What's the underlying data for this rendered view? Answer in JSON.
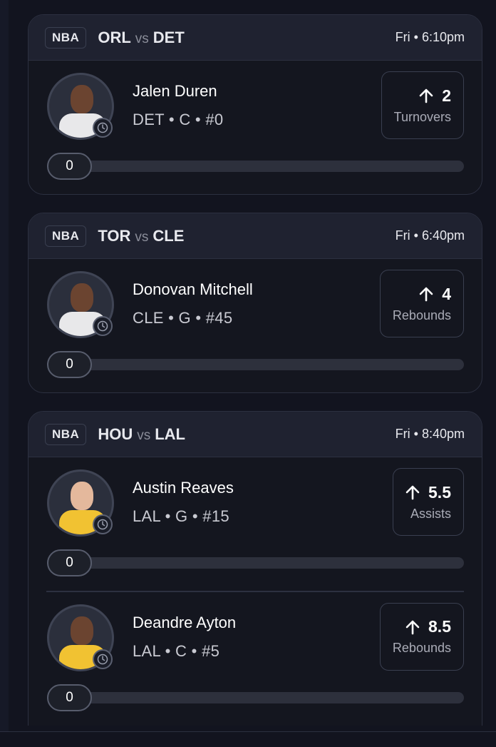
{
  "games": [
    {
      "league": "NBA",
      "team_a": "ORL",
      "vs": "vs",
      "team_b": "DET",
      "time": "Fri • 6:10pm",
      "picks": [
        {
          "name": "Jalen Duren",
          "meta": "DET • C • #0",
          "direction": "up",
          "line": "2",
          "stat": "Turnovers",
          "progress": "0",
          "jersey": "#e8e8ea",
          "skin": "dark"
        }
      ]
    },
    {
      "league": "NBA",
      "team_a": "TOR",
      "vs": "vs",
      "team_b": "CLE",
      "time": "Fri • 6:40pm",
      "picks": [
        {
          "name": "Donovan Mitchell",
          "meta": "CLE • G • #45",
          "direction": "up",
          "line": "4",
          "stat": "Rebounds",
          "progress": "0",
          "jersey": "#e8e8ea",
          "skin": "dark"
        }
      ]
    },
    {
      "league": "NBA",
      "team_a": "HOU",
      "vs": "vs",
      "team_b": "LAL",
      "time": "Fri • 8:40pm",
      "picks": [
        {
          "name": "Austin Reaves",
          "meta": "LAL • G • #15",
          "direction": "up",
          "line": "5.5",
          "stat": "Assists",
          "progress": "0",
          "jersey": "#f1c232",
          "skin": "light"
        },
        {
          "name": "Deandre Ayton",
          "meta": "LAL • C • #5",
          "direction": "up",
          "line": "8.5",
          "stat": "Rebounds",
          "progress": "0",
          "jersey": "#f1c232",
          "skin": "dark"
        }
      ]
    }
  ]
}
